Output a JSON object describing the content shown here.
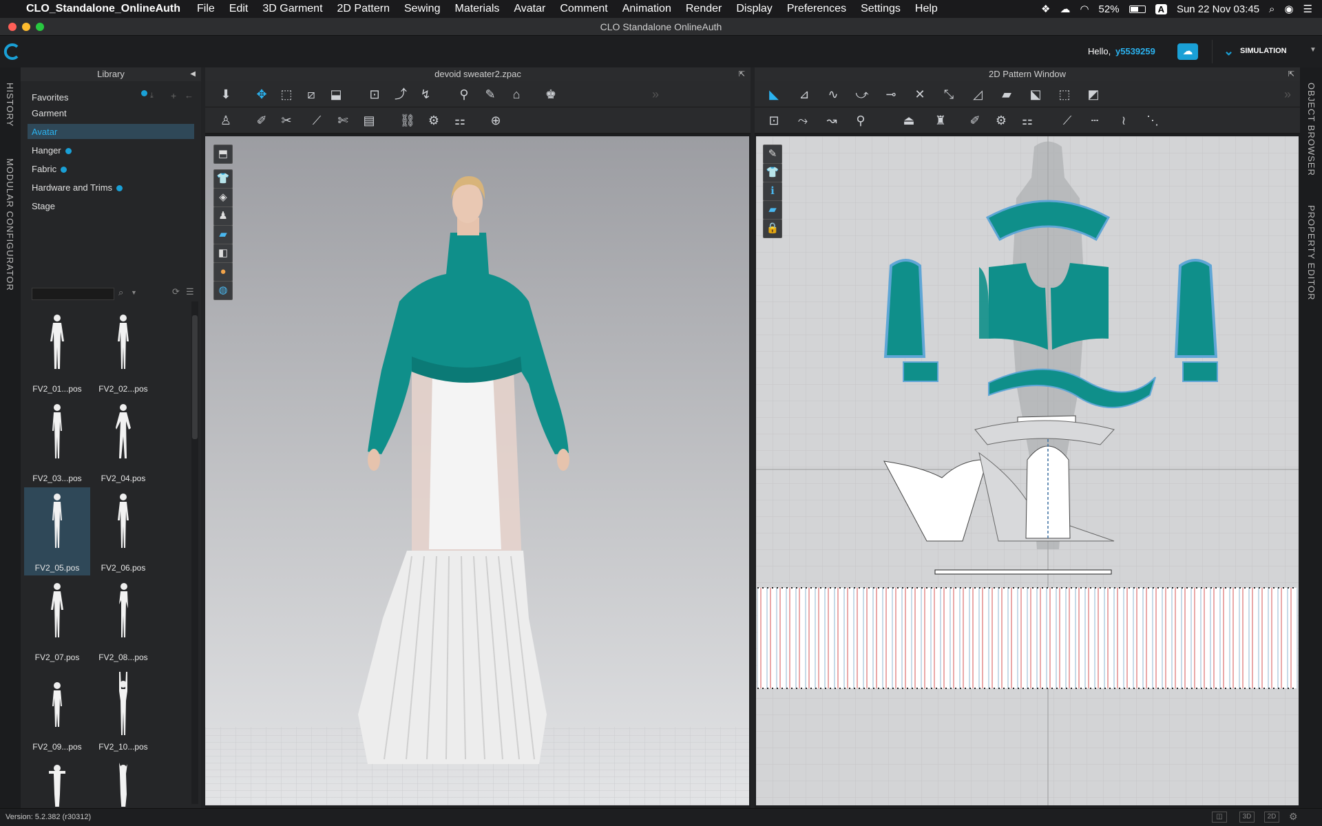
{
  "menubar": {
    "app": "CLO_Standalone_OnlineAuth",
    "items": [
      "File",
      "Edit",
      "3D Garment",
      "2D Pattern",
      "Sewing",
      "Materials",
      "Avatar",
      "Comment",
      "Animation",
      "Render",
      "Display",
      "Preferences",
      "Settings",
      "Help"
    ],
    "battery": "52%",
    "input_source": "A",
    "clock": "Sun 22 Nov  03:45"
  },
  "window": {
    "title": "CLO Standalone OnlineAuth"
  },
  "header": {
    "greeting": "Hello,",
    "username": "y5539259",
    "simulation_label": "SIMULATION"
  },
  "side_tabs": {
    "left": [
      "HISTORY",
      "MODULAR CONFIGURATOR"
    ],
    "right": [
      "OBJECT BROWSER",
      "PROPERTY EDITOR"
    ]
  },
  "library": {
    "title": "Library",
    "categories": [
      {
        "label": "Favorites",
        "badge": true
      },
      {
        "label": "Garment",
        "badge": false
      },
      {
        "label": "Avatar",
        "badge": false,
        "selected": true
      },
      {
        "label": "Hanger",
        "badge": true
      },
      {
        "label": "Fabric",
        "badge": true
      },
      {
        "label": "Hardware and Trims",
        "badge": true
      },
      {
        "label": "Stage",
        "badge": false
      }
    ],
    "search_placeholder": "",
    "avatars": [
      "FV2_01...pos",
      "FV2_02...pos",
      "FV2_03...pos",
      "FV2_04.pos",
      "FV2_05.pos",
      "FV2_06.pos",
      "FV2_07.pos",
      "FV2_08...pos",
      "FV2_09...pos",
      "FV2_10...pos"
    ],
    "selected_avatar": "FV2_05.pos"
  },
  "viewport3d": {
    "title": "devoid sweater2.zpac"
  },
  "pattern2d": {
    "title": "2D Pattern Window"
  },
  "colors": {
    "accent": "#1aa0d6",
    "garment": "#0f8f8a",
    "selection": "#2f4858"
  },
  "status": {
    "version": "Version: 5.2.382 (r30312)",
    "view_buttons": [
      "3D",
      "2D"
    ]
  }
}
